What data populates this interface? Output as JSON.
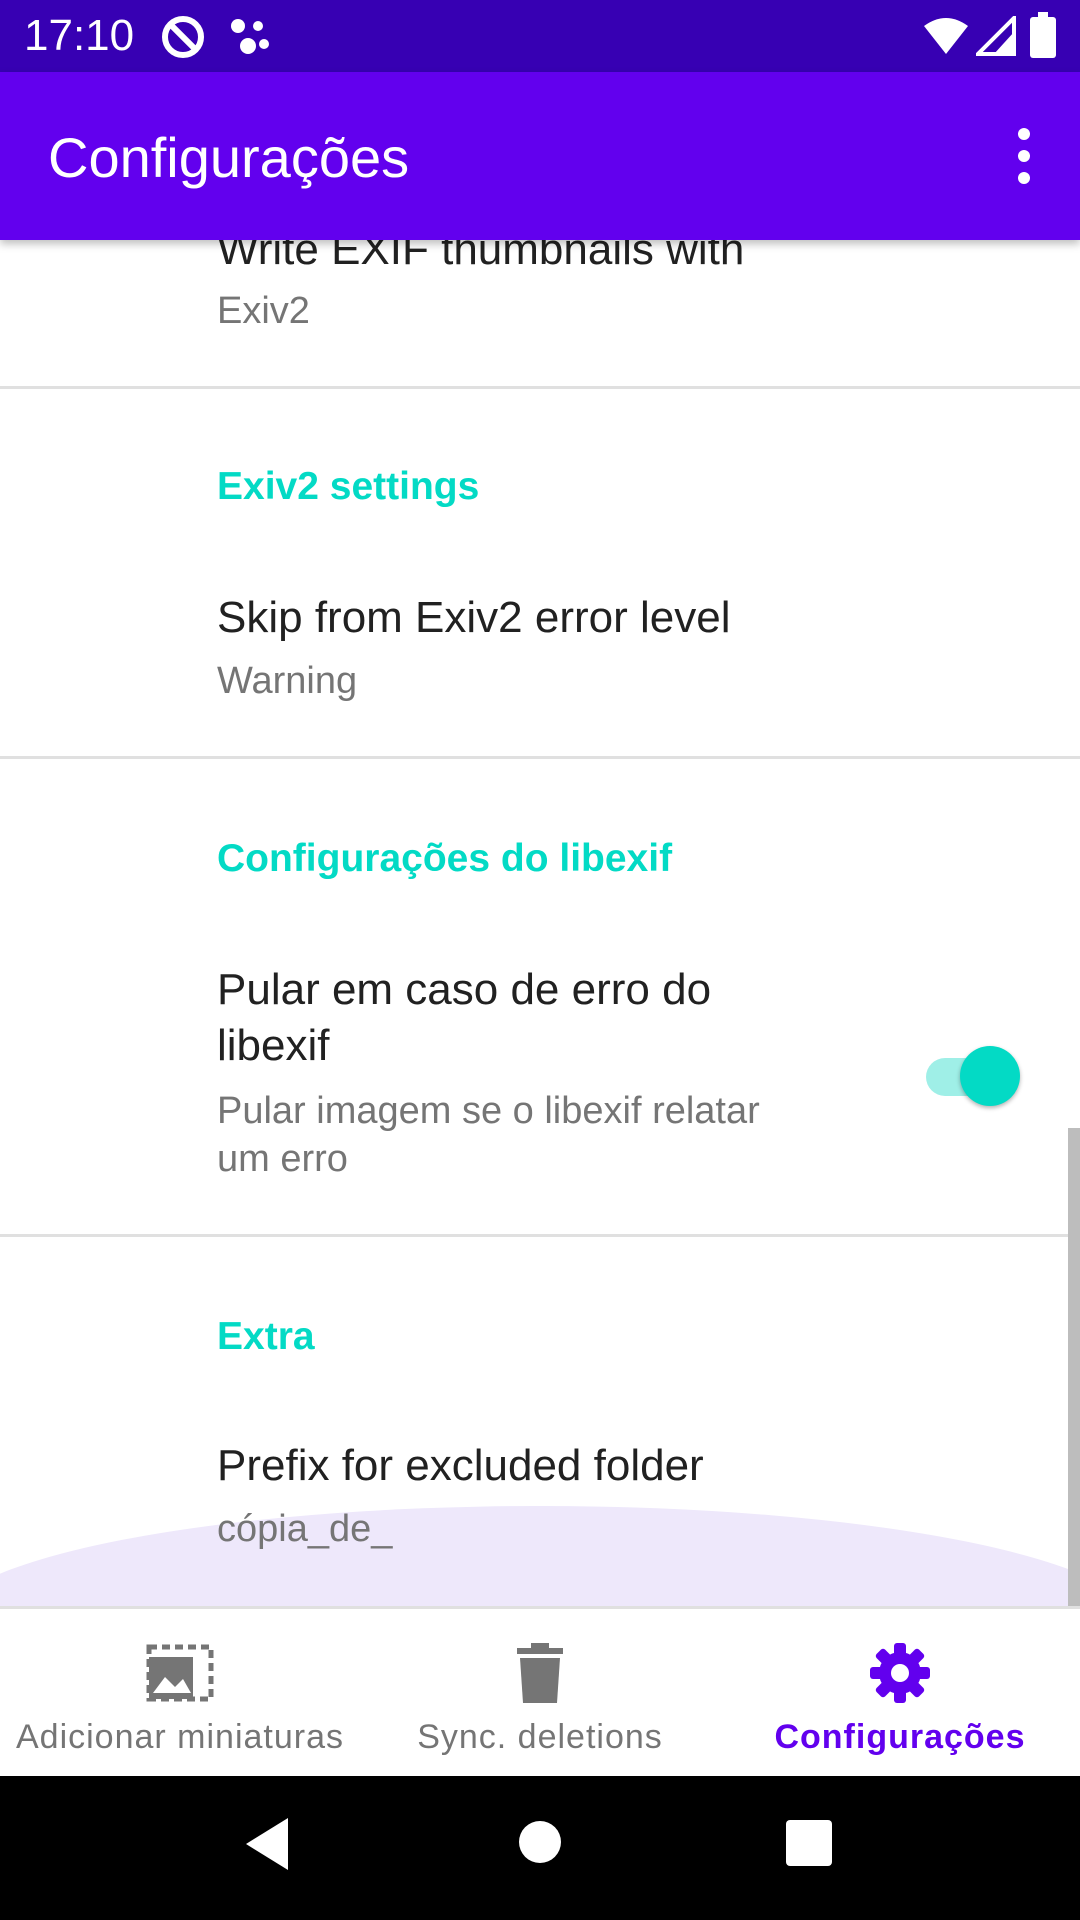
{
  "status_bar": {
    "time": "17:10"
  },
  "app_bar": {
    "title": "Configurações",
    "menu_icon": "more-vert-icon"
  },
  "preferences": {
    "write_thumbnails": {
      "title": "Write EXIF thumbnails with",
      "summary": "Exiv2"
    },
    "exiv2_category": "Exiv2 settings",
    "skip_error_level": {
      "title": "Skip from Exiv2 error level",
      "summary": "Warning"
    },
    "libexif_category": "Configurações do libexif",
    "skip_libexif_error": {
      "title_line1": "Pular em caso de erro do",
      "title_line2": "libexif",
      "summary_line1": "Pular imagem se o libexif relatar",
      "summary_line2": "um erro",
      "enabled": true
    },
    "extra_category": "Extra",
    "excluded_prefix": {
      "title": "Prefix for excluded folder",
      "summary": "cópia_de_"
    }
  },
  "bottom_nav": {
    "items": [
      {
        "label": "Adicionar miniaturas",
        "icon": "add-thumbnails-icon",
        "active": false
      },
      {
        "label": "Sync. deletions",
        "icon": "trash-icon",
        "active": false
      },
      {
        "label": "Configurações",
        "icon": "gear-icon",
        "active": true
      }
    ]
  },
  "colors": {
    "primary": "#6200EE",
    "primary_dark": "#3700B3",
    "accent": "#03DAC5"
  }
}
